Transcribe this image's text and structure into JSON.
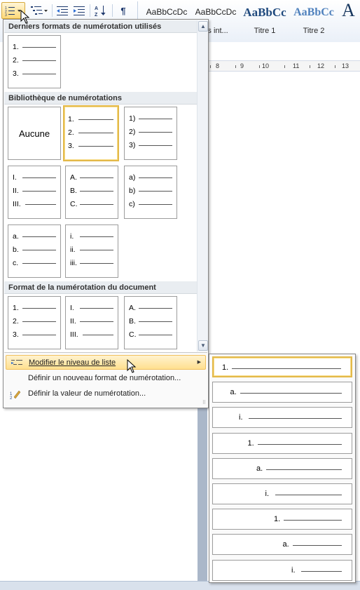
{
  "ribbon": {
    "styles": [
      {
        "sample": "AaBbCcDc",
        "name": ""
      },
      {
        "sample": "AaBbCcDc",
        "name": "ns int..."
      },
      {
        "sample": "AaBbCc",
        "name": "Titre 1"
      },
      {
        "sample": "AaBbCc",
        "name": "Titre 2"
      },
      {
        "sample": "A",
        "name": ""
      }
    ],
    "pilcrow": "¶",
    "sort_icon_label": "A Z"
  },
  "ruler": {
    "labels": [
      "8",
      "9",
      "10",
      "11",
      "12",
      "13"
    ]
  },
  "numbering_menu": {
    "recent_header": "Derniers formats de numérotation utilisés",
    "library_header": "Bibliothèque de numérotations",
    "document_header": "Format de la numérotation du document",
    "recent_tiles": [
      {
        "labels": [
          "1.",
          "2.",
          "3."
        ]
      }
    ],
    "library_tiles": [
      {
        "none_label": "Aucune"
      },
      {
        "labels": [
          "1.",
          "2.",
          "3."
        ],
        "selected": true
      },
      {
        "labels": [
          "1)",
          "2)",
          "3)"
        ]
      },
      {
        "labels": [
          "I.",
          "II.",
          "III."
        ]
      },
      {
        "labels": [
          "A.",
          "B.",
          "C."
        ]
      },
      {
        "labels": [
          "a)",
          "b)",
          "c)"
        ]
      },
      {
        "labels": [
          "a.",
          "b.",
          "c."
        ]
      },
      {
        "labels": [
          "i.",
          "ii.",
          "iii."
        ]
      }
    ],
    "document_tiles": [
      {
        "labels": [
          "1.",
          "2.",
          "3."
        ]
      },
      {
        "labels": [
          "I.",
          "II.",
          "III."
        ]
      },
      {
        "labels": [
          "A.",
          "B.",
          "C."
        ]
      }
    ],
    "commands": {
      "change_level": "Modifier le niveau de liste",
      "define_format": "Définir un nouveau format de numérotation...",
      "set_value": "Définir la valeur de numérotation..."
    }
  },
  "list_levels": {
    "items": [
      {
        "label": "1.",
        "indent_level": 1
      },
      {
        "label": "a.",
        "indent_level": 2
      },
      {
        "label": "i.",
        "indent_level": 3
      },
      {
        "label": "1.",
        "indent_level": 4
      },
      {
        "label": "a.",
        "indent_level": 5
      },
      {
        "label": "i.",
        "indent_level": 6
      },
      {
        "label": "1.",
        "indent_level": 7
      },
      {
        "label": "a.",
        "indent_level": 8
      },
      {
        "label": "i.",
        "indent_level": 9
      }
    ],
    "selected_level": 1
  },
  "colors": {
    "accent_selected_border": "#e3b94a",
    "menu_hover": "#ffe08f",
    "heading_style_blue": "#365f91"
  }
}
